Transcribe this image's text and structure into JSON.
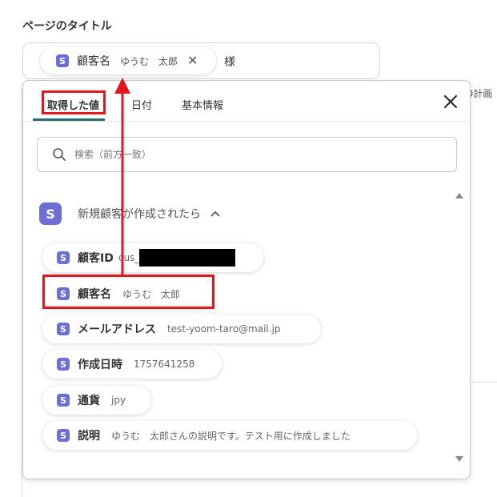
{
  "page_title_label": "ページのタイトル",
  "title_field": {
    "chip": {
      "badge": "S",
      "name": "顧客名",
      "value": "ゆうむ　太郎"
    },
    "suffix": "様"
  },
  "background_edge_text": "D計画",
  "popup": {
    "tabs": [
      {
        "label": "取得した値",
        "active": true
      },
      {
        "label": "日付",
        "active": false
      },
      {
        "label": "基本情報",
        "active": false
      }
    ],
    "search_placeholder": "検索（前方一致）",
    "section": {
      "badge": "S",
      "title": "新規顧客が作成されたら",
      "expanded": true
    },
    "items": [
      {
        "badge": "S",
        "name": "顧客ID",
        "value": "cus_",
        "value_redacted": true
      },
      {
        "badge": "S",
        "name": "顧客名",
        "value": "ゆうむ　太郎"
      },
      {
        "badge": "S",
        "name": "メールアドレス",
        "value": "test-yoom-taro@mail.jp"
      },
      {
        "badge": "S",
        "name": "作成日時",
        "value": "1757641258"
      },
      {
        "badge": "S",
        "name": "通貨",
        "value": "jpy"
      },
      {
        "badge": "S",
        "name": "説明",
        "value": "ゆうむ　太郎さんの説明です。テスト用に作成しました"
      }
    ]
  },
  "colors": {
    "brand_badge": "#6c6fd6",
    "annotation_red": "#e5161b",
    "tab_underline": "#2a6b6b"
  }
}
